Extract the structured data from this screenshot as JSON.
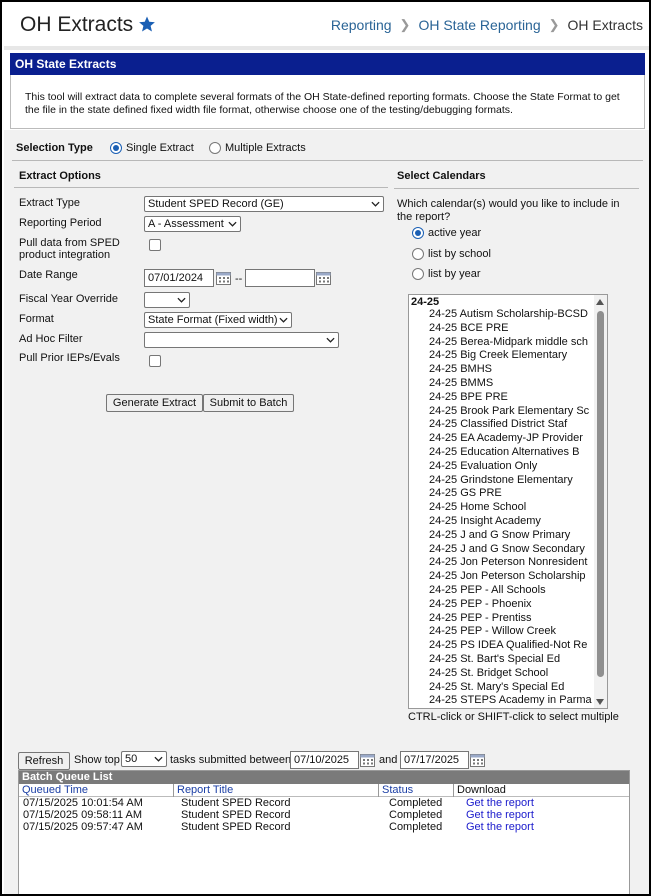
{
  "header": {
    "title": "OH Extracts",
    "breadcrumb": [
      "Reporting",
      "OH State Reporting",
      "OH Extracts"
    ]
  },
  "band_title": "OH State Extracts",
  "intro": "This tool will extract data to complete several formats of the OH State-defined reporting formats. Choose the State Format to get the file in the state defined fixed width file format, otherwise choose one of the testing/debugging formats.",
  "selection_type": {
    "label": "Selection Type",
    "single": "Single Extract",
    "multiple": "Multiple Extracts",
    "selected": "Single Extract"
  },
  "extract_options": {
    "title": "Extract Options",
    "extract_type_label": "Extract Type",
    "extract_type_value": "Student SPED Record (GE)",
    "reporting_period_label": "Reporting Period",
    "reporting_period_value": "A - Assessment",
    "pull_sped_label_1": "Pull data from SPED",
    "pull_sped_label_2": "product integration",
    "date_range_label": "Date Range",
    "date_from": "07/01/2024",
    "date_sep": "--",
    "date_to": "",
    "fiscal_label": "Fiscal Year Override",
    "fiscal_value": "",
    "format_label": "Format",
    "format_value": "State Format (Fixed width)",
    "adhoc_label": "Ad Hoc Filter",
    "adhoc_value": "",
    "prior_ieps_label": "Pull Prior IEPs/Evals",
    "generate_btn": "Generate Extract",
    "batch_btn": "Submit to Batch"
  },
  "calendars": {
    "title": "Select Calendars",
    "question": "Which calendar(s) would you like to include in the report?",
    "options": [
      "active year",
      "list by school",
      "list by year"
    ],
    "selected": "active year",
    "group": "24-25",
    "items": [
      "24-25 Autism Scholarship-BCSD",
      "24-25 BCE PRE",
      "24-25 Berea-Midpark middle sch",
      "24-25 Big Creek Elementary",
      "24-25 BMHS",
      "24-25 BMMS",
      "24-25 BPE PRE",
      "24-25 Brook Park Elementary Sc",
      "24-25 Classified District Staf",
      "24-25 EA Academy-JP Provider",
      "24-25 Education Alternatives B",
      "24-25 Evaluation Only",
      "24-25 Grindstone Elementary",
      "24-25 GS PRE",
      "24-25 Home School",
      "24-25 Insight Academy",
      "24-25 J and G Snow Primary",
      "24-25 J and G Snow Secondary",
      "24-25 Jon Peterson Nonresident",
      "24-25 Jon Peterson Scholarship",
      "24-25 PEP - All Schools",
      "24-25 PEP - Phoenix",
      "24-25 PEP - Prentiss",
      "24-25 PEP - Willow Creek",
      "24-25 PS IDEA Qualified-Not Re",
      "24-25 St. Bart's Special Ed",
      "24-25 St. Bridget School",
      "24-25 St. Mary's Special Ed",
      "24-25 STEPS Academy in Parma"
    ],
    "hint": "CTRL-click or SHIFT-click to select multiple"
  },
  "queue_controls": {
    "refresh": "Refresh",
    "show_top": "Show top",
    "count": "50",
    "between": "tasks submitted between",
    "from": "07/10/2025",
    "and": "and",
    "to": "07/17/2025"
  },
  "batch": {
    "title": "Batch Queue List",
    "headers": [
      "Queued Time",
      "Report Title",
      "Status",
      "Download"
    ],
    "rows": [
      {
        "time": "07/15/2025 10:01:54 AM",
        "title": "Student SPED Record",
        "status": "Completed",
        "download": "Get the report"
      },
      {
        "time": "07/15/2025 09:58:11 AM",
        "title": "Student SPED Record",
        "status": "Completed",
        "download": "Get the report"
      },
      {
        "time": "07/15/2025 09:57:47 AM",
        "title": "Student SPED Record",
        "status": "Completed",
        "download": "Get the report"
      }
    ]
  },
  "colors": {
    "band": "#0a1f8f",
    "link": "#2a6496",
    "star": "#1a5fb4"
  }
}
